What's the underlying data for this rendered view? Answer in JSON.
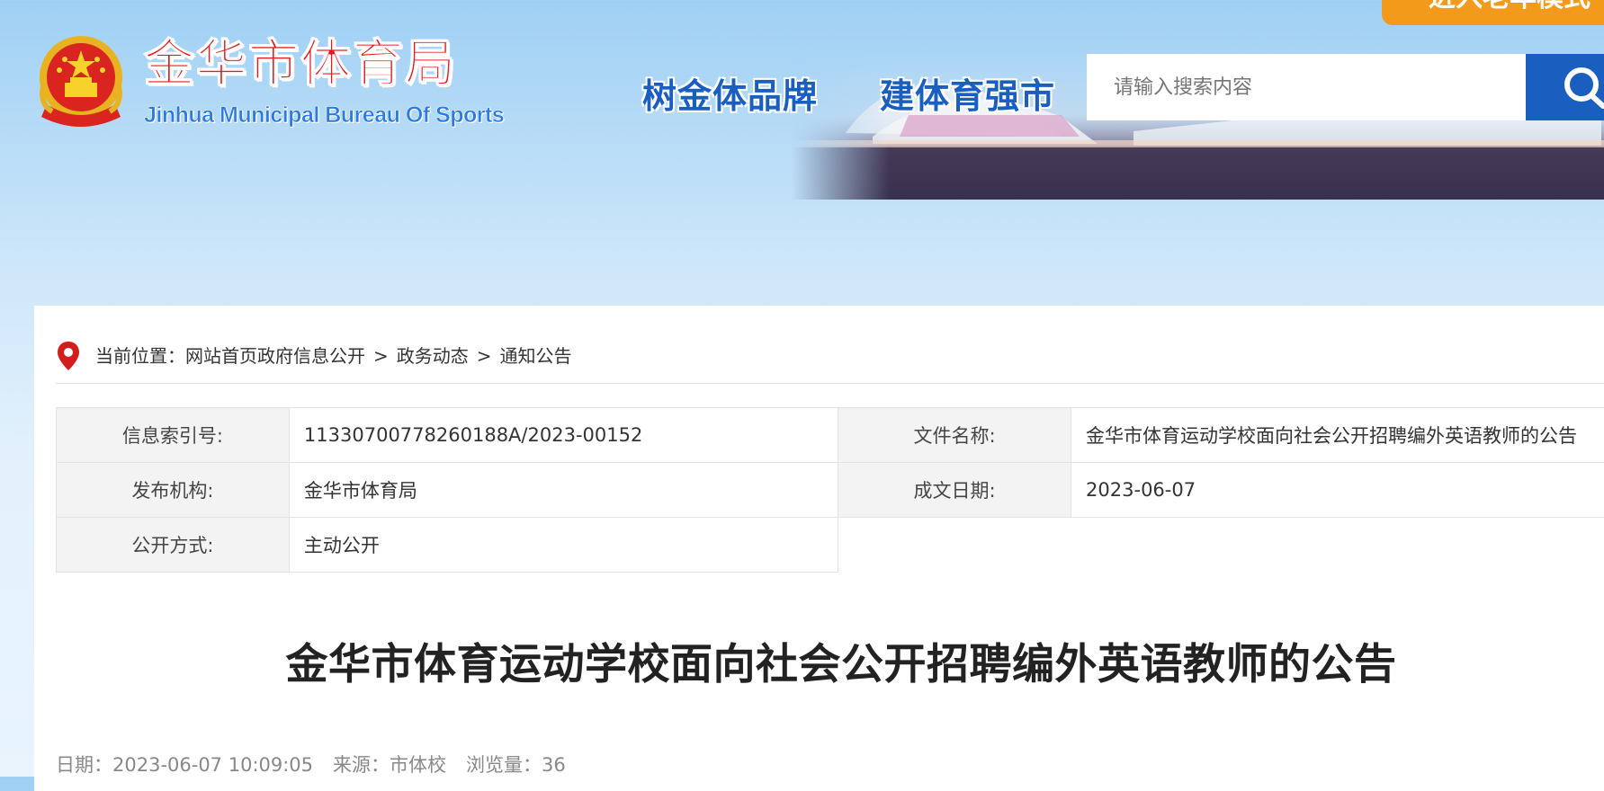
{
  "header": {
    "site_title": "金华市体育局",
    "site_subtitle": "Jinhua Municipal Bureau Of Sports",
    "slogan_1": "树金体品牌",
    "slogan_2": "建体育强市",
    "search_placeholder": "请输入搜索内容",
    "elder_mode_label": "进入老年模式",
    "search_icon": "search-icon",
    "emblem_icon": "national-emblem-icon"
  },
  "breadcrumb": {
    "prefix": "当前位置：",
    "items": [
      "网站首页政府信息公开",
      "政务动态",
      "通知公告"
    ],
    "separator": ">",
    "icon": "location-pin-icon"
  },
  "meta": {
    "index_no_label": "信息索引号:",
    "index_no_value": "11330700778260188A/2023-00152",
    "doc_name_label": "文件名称:",
    "doc_name_value": "金华市体育运动学校面向社会公开招聘编外英语教师的公告",
    "publisher_label": "发布机构:",
    "publisher_value": "金华市体育局",
    "date_label": "成文日期:",
    "date_value": "2023-06-07",
    "disclosure_label": "公开方式:",
    "disclosure_value": "主动公开"
  },
  "article": {
    "title": "金华市体育运动学校面向社会公开招聘编外英语教师的公告",
    "date_label": "日期：",
    "date_value": "2023-06-07 10:09:05",
    "source_label": "来源：",
    "source_value": "市体校",
    "views_label": "浏览量：",
    "views_value": "36"
  },
  "colors": {
    "title_red": "#e01c1c",
    "brand_blue": "#1a5fc0",
    "elder_orange": "#f39a1a"
  }
}
